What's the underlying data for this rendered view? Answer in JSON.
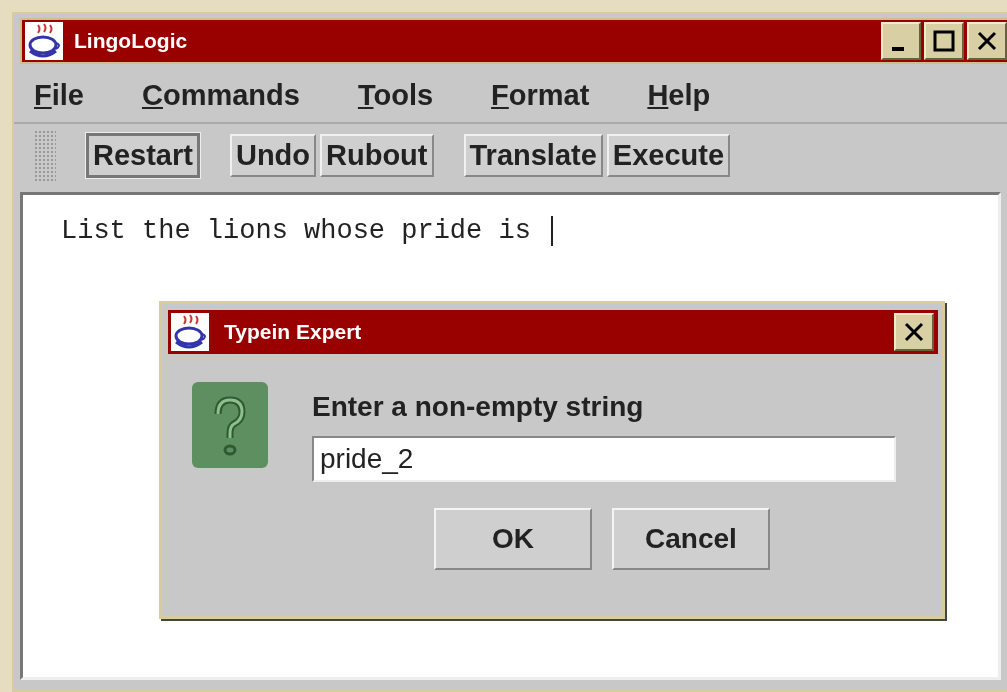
{
  "window": {
    "title": "LingoLogic"
  },
  "menu": [
    "File",
    "Commands",
    "Tools",
    "Format",
    "Help"
  ],
  "toolbar": [
    [
      {
        "label": "Restart",
        "focused": true
      }
    ],
    [
      {
        "label": "Undo",
        "focused": false
      },
      {
        "label": "Rubout",
        "focused": false
      }
    ],
    [
      {
        "label": "Translate",
        "focused": false
      },
      {
        "label": "Execute",
        "focused": false
      }
    ]
  ],
  "editor": {
    "text": "List the lions whose pride is "
  },
  "dialog": {
    "title": "Typein Expert",
    "message": "Enter a non-empty string",
    "value": "pride_2",
    "buttons": [
      "OK",
      "Cancel"
    ]
  }
}
